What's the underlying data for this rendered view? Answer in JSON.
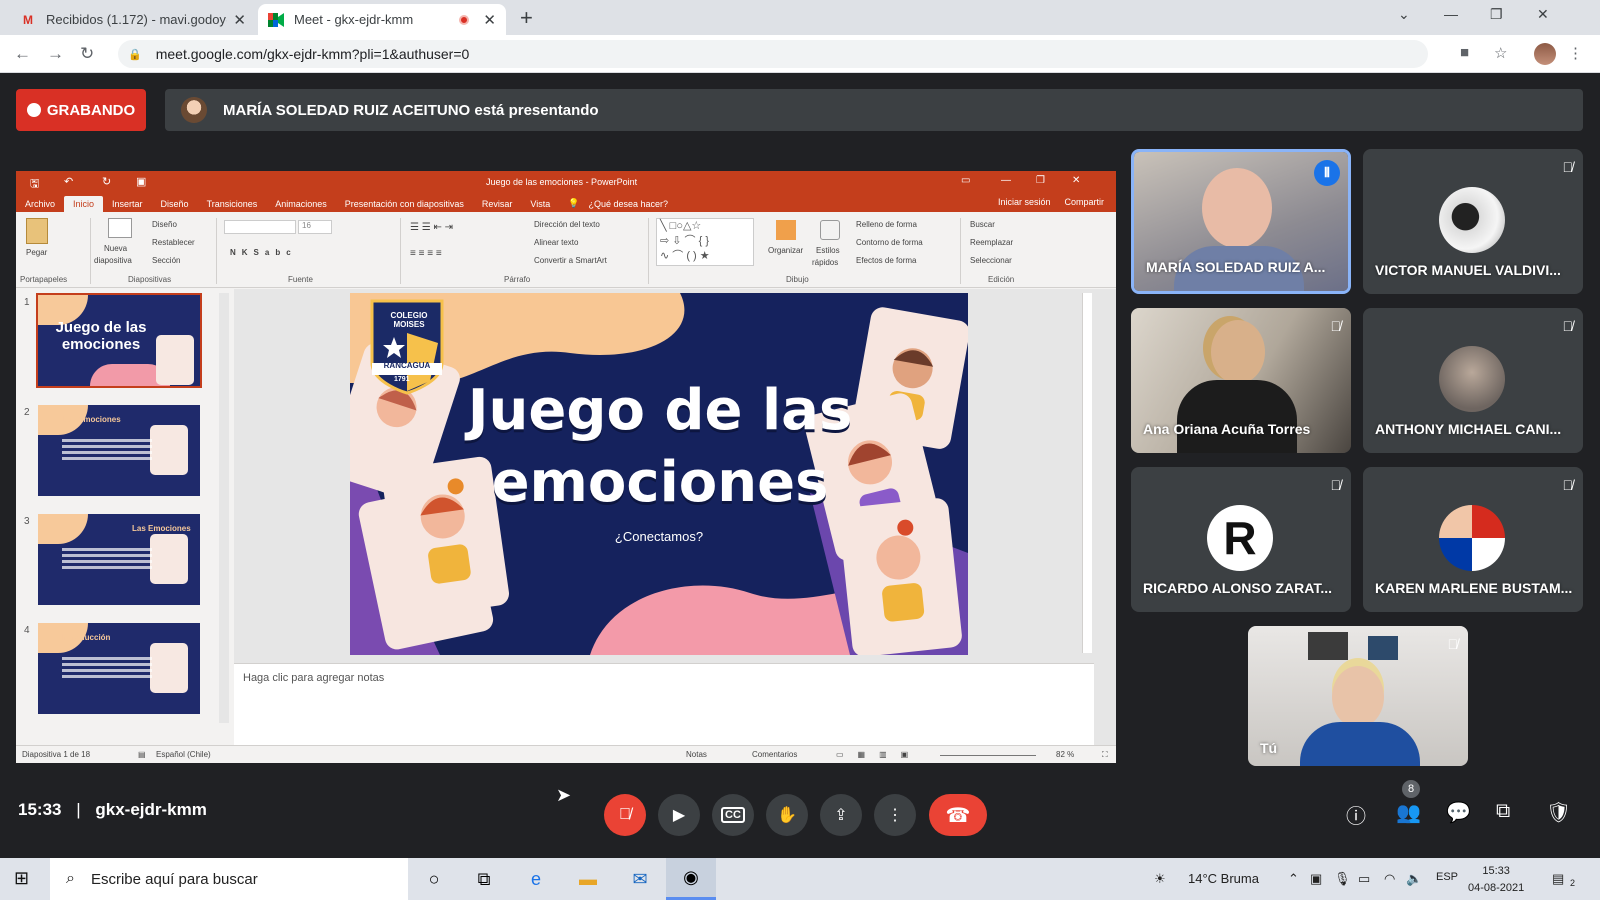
{
  "browser": {
    "tabs": [
      {
        "title": "Recibidos (1.172) - mavi.godoy@",
        "icon": "gmail-icon"
      },
      {
        "title": "Meet - gkx-ejdr-kmm",
        "icon": "meet-icon",
        "recording": true
      }
    ],
    "url": "meet.google.com/gkx-ejdr-kmm?pli=1&authuser=0"
  },
  "meet": {
    "recording_label": "GRABANDO",
    "presenting_text": "MARÍA SOLEDAD RUIZ ACEITUNO está presentando",
    "meeting_time": "15:33",
    "meeting_code": "gkx-ejdr-kmm",
    "participant_count": "8",
    "participants": [
      {
        "name": "MARÍA SOLEDAD RUIZ A...",
        "speaking": true
      },
      {
        "name": "VICTOR MANUEL VALDIVI...",
        "muted": true
      },
      {
        "name": "Ana Oriana Acuña Torres",
        "muted": true
      },
      {
        "name": "ANTHONY MICHAEL CANI...",
        "muted": true
      },
      {
        "name": "RICARDO ALONSO ZARAT...",
        "muted": true
      },
      {
        "name": "KAREN MARLENE BUSTAM...",
        "muted": true
      },
      {
        "name": "Tú",
        "muted": true
      }
    ],
    "colors": {
      "accent_red": "#ea4335",
      "bg": "#202124",
      "tile": "#3c4043",
      "speaking": "#1a73e8"
    }
  },
  "ppt": {
    "window_title": "Juego de las emociones - PowerPoint",
    "menu": [
      "Archivo",
      "Inicio",
      "Insertar",
      "Diseño",
      "Transiciones",
      "Animaciones",
      "Presentación con diapositivas",
      "Revisar",
      "Vista"
    ],
    "help_text": "¿Qué desea hacer?",
    "signin": "Iniciar sesión",
    "share": "Compartir",
    "ribbon": {
      "pegar": "Pegar",
      "portapapeles": "Portapapeles",
      "nueva": "Nueva",
      "diapositiva": "diapositiva",
      "diseno": "Diseño",
      "restablecer": "Restablecer",
      "seccion": "Sección",
      "diapositivas": "Diapositivas",
      "font_size": "16",
      "fuente": "Fuente",
      "direccion": "Dirección del texto",
      "alinear": "Alinear texto",
      "smartart": "Convertir a SmartArt",
      "parrafo": "Párrafo",
      "organizar": "Organizar",
      "estilos": "Estilos",
      "rapidos": "rápidos",
      "relleno": "Relleno de forma",
      "contorno": "Contorno de forma",
      "efectos": "Efectos de forma",
      "dibujo": "Dibujo",
      "buscar": "Buscar",
      "reemplazar": "Reemplazar",
      "seleccionar": "Seleccionar",
      "edicion": "Edición"
    },
    "slide_numbers": [
      "1",
      "2",
      "3",
      "4"
    ],
    "thumb_titles": [
      "Juego de las emociones",
      "Las Emociones",
      "Las Emociones",
      "Introducción"
    ],
    "slide": {
      "school": "COLEGIO MOISES",
      "school_city": "RANCAGUA",
      "school_year": "1791",
      "title_line1": "Juego de las",
      "title_line2": "emociones",
      "subtitle": "¿Conectamos?"
    },
    "notes_placeholder": "Haga clic para agregar notas",
    "status_slide": "Diapositiva 1 de 18",
    "status_lang": "Español (Chile)",
    "status_notes": "Notas",
    "status_comments": "Comentarios",
    "zoom": "82 %",
    "colors": {
      "accent": "#c43e1c",
      "slide_bg": "#15225d"
    }
  },
  "taskbar": {
    "search_placeholder": "Escribe aquí para buscar",
    "weather": "14°C  Bruma",
    "lang": "ESP",
    "time": "15:33",
    "date": "04-08-2021",
    "notif_count": "2"
  }
}
